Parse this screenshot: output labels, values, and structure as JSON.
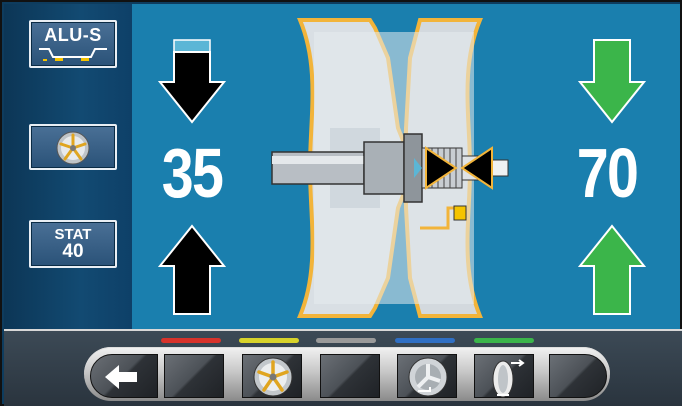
{
  "sidebar": {
    "alu_button": {
      "label": "ALU-S",
      "icon": "rim-profile-icon"
    },
    "wheel_button": {
      "icon": "alloy-wheel-icon"
    },
    "stat_button": {
      "label_line1": "STAT",
      "label_line2": "40"
    }
  },
  "main": {
    "left_value": "35",
    "right_value": "70",
    "left_arrows": {
      "color": "#000000",
      "icons": [
        "arrow-down-icon",
        "arrow-up-icon"
      ]
    },
    "right_arrows": {
      "color": "#3bb54a",
      "icons": [
        "arrow-down-icon",
        "arrow-up-icon"
      ]
    },
    "rim_diagram": "rim-cross-section-icon",
    "background_color": "#1a7fae"
  },
  "bottom_bar": {
    "color_tabs": [
      {
        "name": "red",
        "color": "#d8332b"
      },
      {
        "name": "yellow",
        "color": "#d8d32a"
      },
      {
        "name": "gray",
        "color": "#9a9a9a"
      },
      {
        "name": "blue",
        "color": "#2f6fc4"
      },
      {
        "name": "green",
        "color": "#3bb54a"
      }
    ],
    "keys": [
      {
        "name": "back",
        "icon": "back-arrow-icon"
      },
      {
        "name": "f1",
        "icon": ""
      },
      {
        "name": "f2",
        "icon": "alloy-wheel-icon"
      },
      {
        "name": "f3",
        "icon": ""
      },
      {
        "name": "f4",
        "icon": "rim-weight-icon"
      },
      {
        "name": "f5",
        "icon": "tire-width-icon"
      },
      {
        "name": "end",
        "icon": ""
      }
    ]
  }
}
